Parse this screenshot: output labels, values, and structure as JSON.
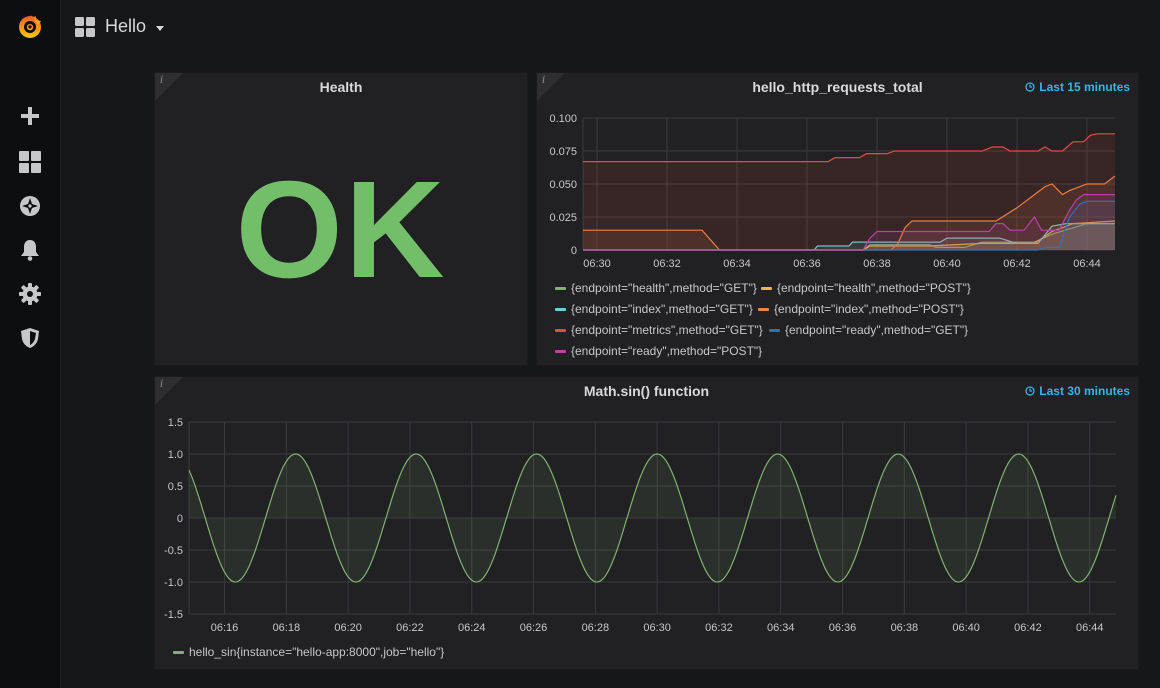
{
  "sidebar": {
    "items": [
      {
        "icon": "grafana-logo-icon"
      },
      {
        "icon": "plus-icon"
      },
      {
        "icon": "dashboards-icon"
      },
      {
        "icon": "explore-compass-icon"
      },
      {
        "icon": "alert-bell-icon"
      },
      {
        "icon": "settings-gear-icon"
      },
      {
        "icon": "shield-icon"
      }
    ]
  },
  "header": {
    "dashboard_title": "Hello"
  },
  "panels": {
    "health": {
      "title": "Health",
      "value": "OK",
      "value_color": "#73bf69",
      "info": "i"
    },
    "requests": {
      "title": "hello_http_requests_total",
      "time_range": "Last 15 minutes",
      "info": "i"
    },
    "sin": {
      "title": "Math.sin() function",
      "time_range": "Last 30 minutes",
      "info": "i"
    }
  },
  "chart_data": [
    {
      "type": "line",
      "title": "hello_http_requests_total",
      "x_ticks": [
        "06:30",
        "06:32",
        "06:34",
        "06:36",
        "06:38",
        "06:40",
        "06:42",
        "06:44"
      ],
      "y_ticks": [
        "0.100",
        "0.075",
        "0.050",
        "0.025",
        "0"
      ],
      "xlim_minutes": [
        29.6,
        44.8
      ],
      "ylim": [
        0,
        0.1
      ],
      "grid": true,
      "legend_placement": "bottom",
      "series": [
        {
          "name": "{endpoint=\"health\",method=\"GET\"}",
          "color": "#7eb26d",
          "points": [
            [
              29.6,
              0
            ],
            [
              37.6,
              0
            ],
            [
              37.8,
              0.004
            ],
            [
              39.5,
              0.004
            ],
            [
              39.7,
              0.002
            ],
            [
              40.5,
              0.002
            ],
            [
              41,
              0.006
            ],
            [
              42.5,
              0.006
            ],
            [
              43,
              0.012
            ],
            [
              44,
              0.02
            ],
            [
              44.8,
              0.02
            ]
          ]
        },
        {
          "name": "{endpoint=\"health\",method=\"POST\"}",
          "color": "#eab839",
          "points": [
            [
              29.6,
              0
            ],
            [
              37.6,
              0
            ],
            [
              37.8,
              0.003
            ],
            [
              39.5,
              0.003
            ],
            [
              41,
              0.005
            ],
            [
              42.5,
              0.005
            ],
            [
              43,
              0.014
            ],
            [
              43.6,
              0.02
            ],
            [
              44.8,
              0.022
            ]
          ]
        },
        {
          "name": "{endpoint=\"index\",method=\"GET\"}",
          "color": "#6ed0e0",
          "points": [
            [
              29.6,
              0
            ],
            [
              36.2,
              0
            ],
            [
              36.3,
              0.003
            ],
            [
              37.2,
              0.003
            ],
            [
              37.3,
              0.006
            ],
            [
              38.5,
              0.006
            ],
            [
              39.8,
              0.006
            ],
            [
              40,
              0.009
            ],
            [
              41.5,
              0.009
            ],
            [
              42,
              0.005
            ],
            [
              42.6,
              0.005
            ],
            [
              43,
              0.018
            ],
            [
              43.4,
              0.02
            ],
            [
              44.8,
              0.02
            ]
          ]
        },
        {
          "name": "{endpoint=\"index\",method=\"POST\"}",
          "color": "#ef843c",
          "points": [
            [
              29.6,
              0.015
            ],
            [
              33,
              0.015
            ],
            [
              33.5,
              0
            ],
            [
              38.4,
              0
            ],
            [
              38.6,
              0.005
            ],
            [
              38.8,
              0.017
            ],
            [
              39,
              0.022
            ],
            [
              40.8,
              0.022
            ],
            [
              41.4,
              0.022
            ],
            [
              42,
              0.032
            ],
            [
              42.5,
              0.042
            ],
            [
              42.8,
              0.048
            ],
            [
              43,
              0.05
            ],
            [
              43.3,
              0.042
            ],
            [
              43.5,
              0.045
            ],
            [
              44,
              0.05
            ],
            [
              44.5,
              0.05
            ],
            [
              44.8,
              0.056
            ]
          ]
        },
        {
          "name": "{endpoint=\"metrics\",method=\"GET\"}",
          "color": "#e24d42",
          "points": [
            [
              29.6,
              0.067
            ],
            [
              36.6,
              0.067
            ],
            [
              36.8,
              0.07
            ],
            [
              37.5,
              0.07
            ],
            [
              37.7,
              0.073
            ],
            [
              38.3,
              0.073
            ],
            [
              38.5,
              0.075
            ],
            [
              41,
              0.075
            ],
            [
              41.3,
              0.078
            ],
            [
              41.6,
              0.078
            ],
            [
              41.8,
              0.075
            ],
            [
              42.6,
              0.075
            ],
            [
              42.8,
              0.078
            ],
            [
              43,
              0.075
            ],
            [
              43.3,
              0.075
            ],
            [
              43.6,
              0.082
            ],
            [
              43.9,
              0.082
            ],
            [
              44.1,
              0.087
            ],
            [
              44.3,
              0.088
            ],
            [
              44.8,
              0.088
            ]
          ]
        },
        {
          "name": "{endpoint=\"ready\",method=\"GET\"}",
          "color": "#1f78c1",
          "points": [
            [
              29.6,
              0
            ],
            [
              42.6,
              0
            ],
            [
              42.8,
              0.002
            ],
            [
              43.2,
              0.002
            ],
            [
              43.5,
              0.025
            ],
            [
              43.8,
              0.035
            ],
            [
              44,
              0.037
            ],
            [
              44.8,
              0.037
            ]
          ]
        },
        {
          "name": "{endpoint=\"ready\",method=\"POST\"}",
          "color": "#ba43a9",
          "points": [
            [
              29.6,
              0
            ],
            [
              36.3,
              0
            ],
            [
              37.6,
              0
            ],
            [
              37.8,
              0.009
            ],
            [
              38,
              0.014
            ],
            [
              39,
              0.014
            ],
            [
              41.2,
              0.014
            ],
            [
              41.4,
              0.02
            ],
            [
              41.6,
              0.02
            ],
            [
              41.8,
              0.015
            ],
            [
              42.2,
              0.015
            ],
            [
              42.5,
              0.025
            ],
            [
              42.7,
              0.015
            ],
            [
              43.2,
              0.015
            ],
            [
              43.5,
              0.03
            ],
            [
              43.7,
              0.038
            ],
            [
              43.9,
              0.042
            ],
            [
              44.8,
              0.042
            ]
          ]
        }
      ]
    },
    {
      "type": "line",
      "title": "Math.sin() function",
      "x_ticks": [
        "06:16",
        "06:18",
        "06:20",
        "06:22",
        "06:24",
        "06:26",
        "06:28",
        "06:30",
        "06:32",
        "06:34",
        "06:36",
        "06:38",
        "06:40",
        "06:42",
        "06:44"
      ],
      "y_ticks": [
        "1.5",
        "1.0",
        "0.5",
        "0",
        "-0.5",
        "-1.0",
        "-1.5"
      ],
      "xlim_minutes": [
        14.85,
        44.85
      ],
      "ylim": [
        -1.5,
        1.5
      ],
      "grid": true,
      "legend_placement": "bottom",
      "series": [
        {
          "name": "hello_sin{instance=\"hello-app:8000\",job=\"hello\"}",
          "color": "#7eb26d",
          "function": "sine",
          "period_minutes": 3.9,
          "peak_minute": 18.3,
          "amplitude": 1
        }
      ]
    }
  ]
}
